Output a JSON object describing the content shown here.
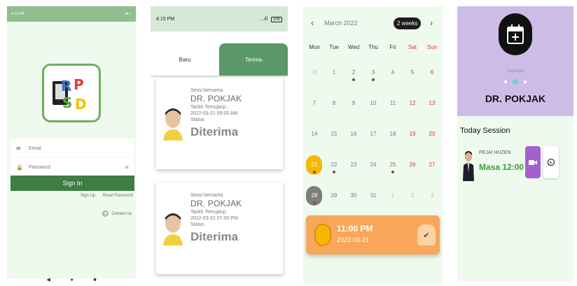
{
  "login": {
    "statusbar": {
      "time": "4:23 PM",
      "right": "all ⚡"
    },
    "email_placeholder": "Email",
    "password_placeholder": "Password",
    "signin_label": "Sign In",
    "signup_label": "Sign Up",
    "reset_label": "Reset Password",
    "contact_label": "Contact us",
    "logo_text": "RPSD",
    "nav": {
      "back": "◀",
      "home": "●",
      "recent": "■"
    }
  },
  "sessions": {
    "statusbar": {
      "time": "4:15 PM",
      "signal": "...ıll",
      "battery": "100"
    },
    "tabs": [
      {
        "label": "Baru"
      },
      {
        "label": "Terima"
      }
    ],
    "cards": [
      {
        "label": "Sessi bersama",
        "doctor": "DR. POKJAK",
        "date_label": "Tarikh Temujanji :",
        "date": "2022-03-21 09:00 AM",
        "status_label": "Status",
        "status": "Diterima"
      },
      {
        "label": "Sessi bersama",
        "doctor": "DR. POKJAK",
        "date_label": "Tarikh Temujanji :",
        "date": "2022-03-22 07:00 PM",
        "status_label": "Status",
        "status": "Diterima"
      }
    ]
  },
  "calendar": {
    "month": "March 2022",
    "range_label": "2 weeks",
    "prev": "‹",
    "next": "›",
    "weekdays": [
      "Mon",
      "Tue",
      "Wed",
      "Thu",
      "Fri",
      "Sat",
      "Sun"
    ],
    "weeks": [
      [
        {
          "d": "28",
          "muted": true
        },
        {
          "d": "1"
        },
        {
          "d": "2",
          "dot": true
        },
        {
          "d": "3",
          "dot": true
        },
        {
          "d": "4"
        },
        {
          "d": "5"
        },
        {
          "d": "6"
        }
      ],
      [
        {
          "d": "7"
        },
        {
          "d": "8"
        },
        {
          "d": "9"
        },
        {
          "d": "10"
        },
        {
          "d": "11"
        },
        {
          "d": "12"
        },
        {
          "d": "13"
        }
      ],
      [
        {
          "d": "14"
        },
        {
          "d": "15"
        },
        {
          "d": "16"
        },
        {
          "d": "17"
        },
        {
          "d": "18"
        },
        {
          "d": "19"
        },
        {
          "d": "20"
        }
      ],
      [
        {
          "d": "21",
          "selected": true,
          "dot": true
        },
        {
          "d": "22",
          "dot": true
        },
        {
          "d": "23"
        },
        {
          "d": "24"
        },
        {
          "d": "25",
          "dot": true
        },
        {
          "d": "26"
        },
        {
          "d": "27"
        }
      ],
      [
        {
          "d": "28",
          "today": true,
          "dot": true
        },
        {
          "d": "29"
        },
        {
          "d": "30"
        },
        {
          "d": "31"
        },
        {
          "d": "1",
          "muted": true
        },
        {
          "d": "2",
          "muted": true
        },
        {
          "d": "3",
          "muted": true
        }
      ]
    ],
    "event": {
      "time": "11:00 PM",
      "date": "2022-03-21"
    }
  },
  "profile": {
    "calendar_label": "Kalendar",
    "doctor_name": "DR. POKJAK",
    "today_title": "Today Session",
    "session": {
      "patient": "PEJAI HUZEN",
      "time": "Masa 12:00 PM"
    }
  }
}
